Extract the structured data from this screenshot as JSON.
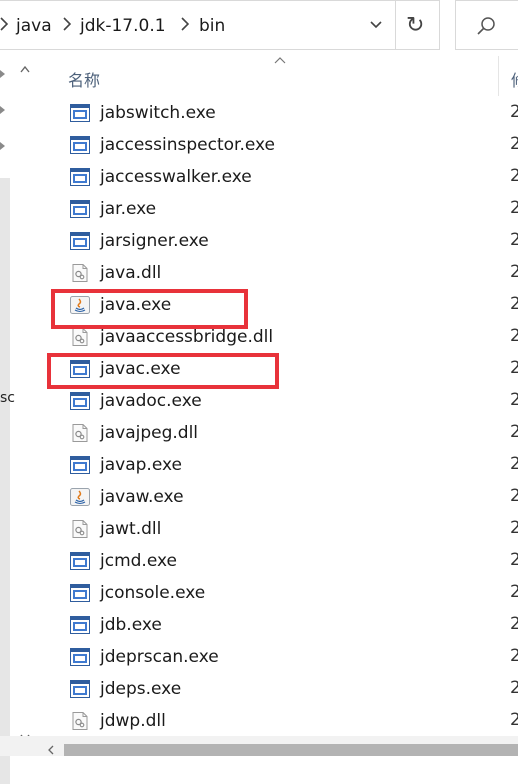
{
  "breadcrumb": {
    "parts": [
      "java",
      "jdk-17.0.1",
      "bin"
    ]
  },
  "toolbar": {
    "refresh_glyph": "↻",
    "search_icon": "search-icon"
  },
  "nav_pane": {
    "partial_label": "sc"
  },
  "columns": {
    "name_header": "名称",
    "next_header_fragment": "修"
  },
  "files": [
    {
      "name": "jabswitch.exe",
      "icon": "exe-icon",
      "date_fragment": "2"
    },
    {
      "name": "jaccessinspector.exe",
      "icon": "exe-icon",
      "date_fragment": "2"
    },
    {
      "name": "jaccesswalker.exe",
      "icon": "exe-icon",
      "date_fragment": "2"
    },
    {
      "name": "jar.exe",
      "icon": "exe-icon",
      "date_fragment": "2"
    },
    {
      "name": "jarsigner.exe",
      "icon": "exe-icon",
      "date_fragment": "2"
    },
    {
      "name": "java.dll",
      "icon": "dll-icon",
      "date_fragment": "2"
    },
    {
      "name": "java.exe",
      "icon": "java-exe-icon",
      "date_fragment": "2"
    },
    {
      "name": "javaaccessbridge.dll",
      "icon": "dll-icon",
      "date_fragment": "2"
    },
    {
      "name": "javac.exe",
      "icon": "exe-icon",
      "date_fragment": "2"
    },
    {
      "name": "javadoc.exe",
      "icon": "exe-icon",
      "date_fragment": "2"
    },
    {
      "name": "javajpeg.dll",
      "icon": "dll-icon",
      "date_fragment": "2"
    },
    {
      "name": "javap.exe",
      "icon": "exe-icon",
      "date_fragment": "2"
    },
    {
      "name": "javaw.exe",
      "icon": "java-exe-icon",
      "date_fragment": "2"
    },
    {
      "name": "jawt.dll",
      "icon": "dll-icon",
      "date_fragment": "2"
    },
    {
      "name": "jcmd.exe",
      "icon": "exe-icon",
      "date_fragment": "2"
    },
    {
      "name": "jconsole.exe",
      "icon": "exe-icon",
      "date_fragment": "2"
    },
    {
      "name": "jdb.exe",
      "icon": "exe-icon",
      "date_fragment": "2"
    },
    {
      "name": "jdeprscan.exe",
      "icon": "exe-icon",
      "date_fragment": "2"
    },
    {
      "name": "jdeps.exe",
      "icon": "exe-icon",
      "date_fragment": "2"
    },
    {
      "name": "jdwp.dll",
      "icon": "dll-icon",
      "date_fragment": "2"
    }
  ],
  "annotations": {
    "highlight_color": "#e8323a",
    "highlighted_files": [
      "java.exe",
      "javac.exe"
    ]
  }
}
